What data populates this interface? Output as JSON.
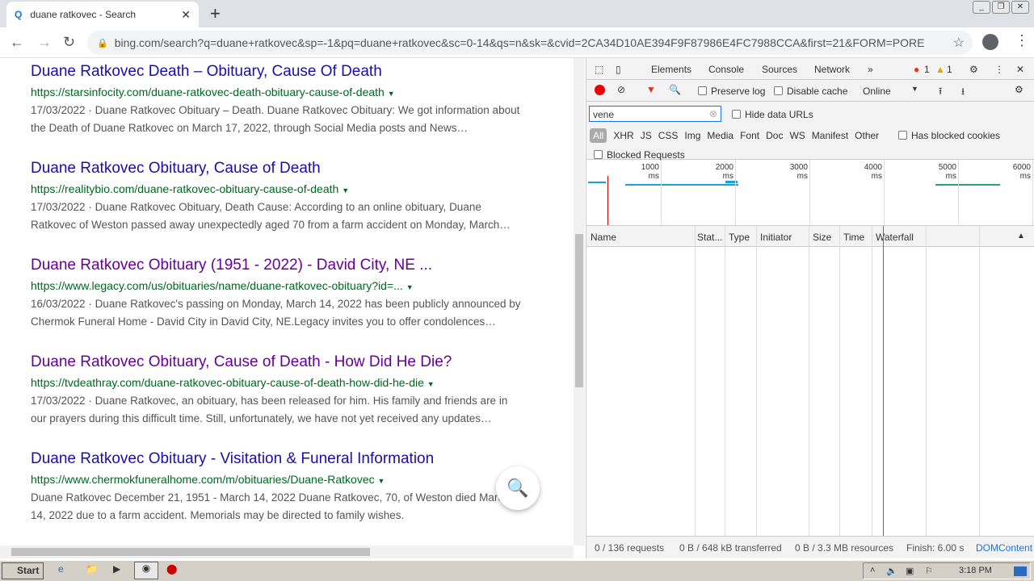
{
  "browser": {
    "tab_title": "duane ratkovec - Search",
    "url": "bing.com/search?q=duane+ratkovec&sp=-1&pq=duane+ratkovec&sc=0-14&qs=n&sk=&cvid=2CA34D10AE394F9F87986E4FC7988CCA&first=21&FORM=PORE"
  },
  "results": [
    {
      "title": "Duane Ratkovec Death – Obituary, Cause Of Death",
      "url": "https://starsinfocity.com/duane-ratkovec-death-obituary-cause-of-death",
      "snippet": "17/03/2022 · Duane Ratkovec Obituary – Death. Duane Ratkovec Obituary: We got information about the Death of Duane Ratkovec on March 17, 2022, through Social Media posts and News…",
      "visited": false
    },
    {
      "title": "Duane Ratkovec Obituary, Cause of Death",
      "url": "https://realitybio.com/duane-ratkovec-obituary-cause-of-death",
      "snippet": "17/03/2022 · Duane Ratkovec Obituary, Death Cause: According to an online obituary, Duane Ratkovec of Weston passed away unexpectedly aged 70 from a farm accident on Monday, March…",
      "visited": false
    },
    {
      "title": "Duane Ratkovec Obituary (1951 - 2022) - David City, NE ...",
      "url": "https://www.legacy.com/us/obituaries/name/duane-ratkovec-obituary?id=...",
      "snippet": "16/03/2022 · Duane Ratkovec's passing on Monday, March 14, 2022 has been publicly announced by Chermok Funeral Home - David City in David City, NE.Legacy invites you to offer condolences…",
      "visited": true
    },
    {
      "title": "Duane Ratkovec Obituary, Cause of Death - How Did He Die?",
      "url": "https://tvdeathray.com/duane-ratkovec-obituary-cause-of-death-how-did-he-die",
      "snippet": "17/03/2022 · Duane Ratkovec, an obituary, has been released for him. His family and friends are in our prayers during this difficult time. Still, unfortunately, we have not yet received any updates…",
      "visited": true
    },
    {
      "title": "Duane Ratkovec Obituary - Visitation & Funeral Information",
      "url": "https://www.chermokfuneralhome.com/m/obituaries/Duane-Ratkovec",
      "snippet": "Duane Ratkovec December 21, 1951 - March 14, 2022 Duane Ratkovec, 70, of Weston died March 14, 2022 due to a farm accident. Memorials may be directed to family wishes.",
      "visited": false
    }
  ],
  "devtools": {
    "tabs": [
      "Elements",
      "Console",
      "Sources",
      "Network"
    ],
    "more": "»",
    "errors": "1",
    "warnings": "1",
    "preserve_log": "Preserve log",
    "disable_cache": "Disable cache",
    "throttle": "Online",
    "filter_value": "vene",
    "hide_data_urls": "Hide data URLs",
    "types": [
      "All",
      "XHR",
      "JS",
      "CSS",
      "Img",
      "Media",
      "Font",
      "Doc",
      "WS",
      "Manifest",
      "Other"
    ],
    "has_blocked_cookies": "Has blocked cookies",
    "blocked_requests": "Blocked Requests",
    "ticks": [
      "1000 ms",
      "2000 ms",
      "3000 ms",
      "4000 ms",
      "5000 ms",
      "6000 ms"
    ],
    "columns": [
      "Name",
      "Stat...",
      "Type",
      "Initiator",
      "Size",
      "Time",
      "Waterfall"
    ],
    "status": {
      "requests": "0 / 136 requests",
      "transferred": "0 B / 648 kB transferred",
      "resources": "0 B / 3.3 MB resources",
      "finish": "Finish: 6.00 s",
      "dom": "DOMContent"
    }
  },
  "taskbar": {
    "start": "Start",
    "time": "3:18 PM"
  }
}
